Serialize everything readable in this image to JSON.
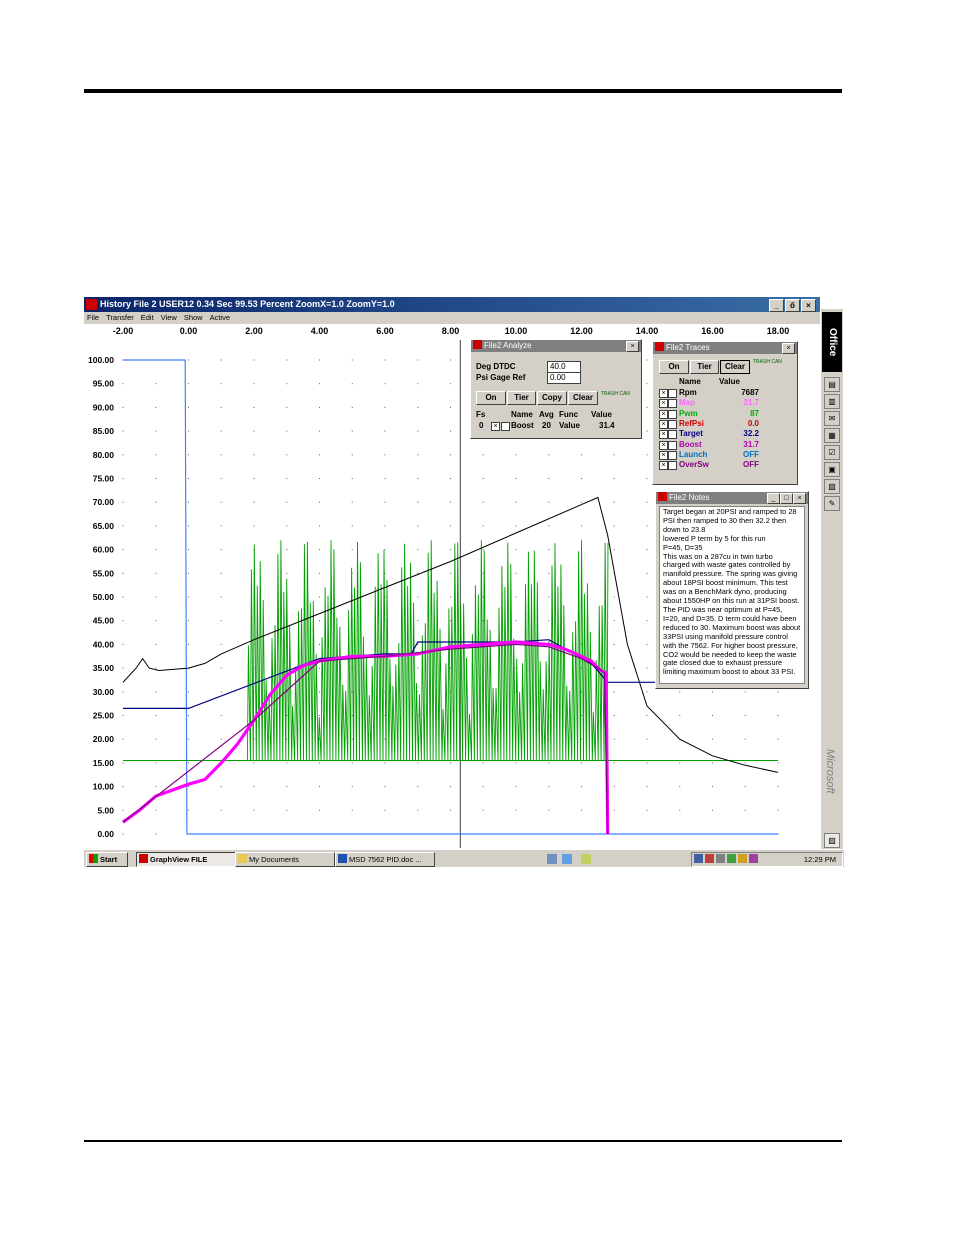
{
  "window": {
    "title": "History File 2   USER12   0.34 Sec  99.53 Percent  ZoomX=1.0  ZoomY=1.0",
    "menu": [
      "File",
      "Transfer",
      "Edit",
      "View",
      "Show",
      "Active"
    ],
    "buttons": [
      "_",
      "ő",
      "×"
    ]
  },
  "chart_data": {
    "type": "line",
    "title": "",
    "xlabel": "",
    "ylabel": "",
    "x_ticks": [
      "-2.00",
      "0.00",
      "2.00",
      "4.00",
      "6.00",
      "8.00",
      "10.00",
      "12.00",
      "14.00",
      "16.00",
      "18.00"
    ],
    "y_ticks": [
      "100.00",
      "95.00",
      "90.00",
      "85.00",
      "80.00",
      "75.00",
      "70.00",
      "65.00",
      "60.00",
      "55.00",
      "50.00",
      "45.00",
      "40.00",
      "35.00",
      "30.00",
      "25.00",
      "20.00",
      "15.00",
      "10.00",
      "5.00",
      "0.00"
    ],
    "xlim": [
      -2,
      18.7
    ],
    "ylim": [
      0,
      100
    ],
    "grid": true,
    "cursor_x": 8.3,
    "series": [
      {
        "name": "Rpm",
        "color": "#000000",
        "x": [
          -2.0,
          -1.6,
          -1.4,
          -1.2,
          -0.9,
          0.0,
          0.5,
          1.0,
          2.0,
          4.0,
          6.0,
          8.0,
          10.0,
          12.0,
          12.5,
          12.8,
          13.4,
          14.0,
          15.0,
          16.0,
          17.0,
          18.0
        ],
        "values": [
          32,
          35,
          37,
          35,
          34.5,
          35,
          36,
          38,
          41,
          46.5,
          52,
          57.5,
          63.5,
          69.5,
          71,
          63,
          40,
          27,
          20,
          16.5,
          14.5,
          13
        ]
      },
      {
        "name": "Map",
        "color": "#ff00ff",
        "x": [
          -2.0,
          -1.5,
          -1.0,
          0.0,
          0.5,
          1.0,
          1.5,
          2.0,
          2.5,
          3.0,
          3.5,
          4.0,
          5.0,
          6.0,
          7.0,
          8.0,
          9.0,
          10.0,
          11.0,
          11.5,
          12.0,
          12.3,
          12.5,
          12.6,
          12.75,
          12.8
        ],
        "values": [
          2.5,
          5,
          8,
          10.5,
          11.5,
          15,
          19,
          24,
          29.5,
          33.5,
          35.5,
          36.5,
          37.5,
          37.5,
          38,
          39.5,
          40,
          40.5,
          40,
          39,
          37.5,
          36.5,
          35,
          34.5,
          34,
          0
        ]
      },
      {
        "name": "Target",
        "color": "#000080",
        "x": [
          -2.0,
          0.0,
          4.0,
          6.0,
          6.8,
          7.0,
          10.0,
          11.0,
          12.3,
          12.8,
          18.0
        ],
        "values": [
          26.5,
          26.5,
          37,
          38,
          38,
          40.5,
          40.5,
          41,
          36,
          32,
          32
        ]
      },
      {
        "name": "Boost",
        "color": "#800080",
        "x": [
          -2.0,
          2.0,
          4.0,
          6.0,
          8.0,
          10.0,
          11.0,
          12.0,
          12.5,
          12.7,
          12.8
        ],
        "values": [
          2.5,
          24,
          36.5,
          37.5,
          39,
          40,
          39.5,
          37,
          35,
          34,
          0
        ]
      },
      {
        "name": "Pwm",
        "color": "#00a000",
        "x": [
          -2.0,
          1.8,
          18.0
        ],
        "values": [
          15.5,
          15.5,
          15.5
        ],
        "oscillation": {
          "from": 1.8,
          "to": 12.8,
          "min": 15.5,
          "max": 62
        }
      },
      {
        "name": "RefPsi",
        "color": "#4080ff",
        "x": [
          -2.0,
          -0.1,
          -0.05,
          0.05,
          18.0
        ],
        "values": [
          100,
          100,
          0,
          0,
          0
        ]
      }
    ]
  },
  "analyze": {
    "title": "File2 Analyze",
    "deg_label": "Deg DTDC",
    "deg_value": "40.0",
    "psi_label": "Psi Gage Ref",
    "psi_value": "0.00",
    "buttons": [
      "On",
      "Tier",
      "Copy",
      "Clear"
    ],
    "trash": "TRASH CAN",
    "headers": [
      "Fs",
      "Name",
      "Avg",
      "Func",
      "Value"
    ],
    "row": {
      "fs": "0",
      "name": "Boost",
      "avg": "20",
      "func": "Value",
      "value": "31.4"
    }
  },
  "traces": {
    "title": "File2 Traces",
    "buttons": [
      "On",
      "Tier",
      "Clear"
    ],
    "trash": "TRASH CAN",
    "headers": [
      "Name",
      "Value"
    ],
    "rows": [
      {
        "name": "Rpm",
        "value": "7687",
        "color": "#000000"
      },
      {
        "name": "Map",
        "value": "31.7",
        "color": "#ff66ff"
      },
      {
        "name": "Pwm",
        "value": "87",
        "color": "#00b000"
      },
      {
        "name": "RefPsi",
        "value": "0.0",
        "color": "#cc0000"
      },
      {
        "name": "Target",
        "value": "32.2",
        "color": "#000080"
      },
      {
        "name": "Boost",
        "value": "31.7",
        "color": "#b000b0"
      },
      {
        "name": "Launch",
        "value": "OFF",
        "color": "#0070c0"
      },
      {
        "name": "OverSw",
        "value": "OFF",
        "color": "#800080"
      }
    ]
  },
  "notes": {
    "title": "File2 Notes",
    "text": "Target began at 20PSI and ramped to 28 PSI then  ramped to 30 then  32.2 then down to 23.8\nlowered P term by 5 for this run\nP=45, D=35\nThis was on a 287cu in twin turbo charged with waste gates controlled by manifold pressure. The spring was giving about 18PSI boost minimum. This test was on a BenchMark dyno, producing about 1550HP on this run at 31PSI boost.\nThe PID was near optimum at P=45, I=20, and D=35.  D term could have been reduced to 30. Maximum boost was  about 33PSI using manifold pressure  control with the 7562. For higher boost  pressure, CO2 would be needed to  keep the waste gate closed due to  exhaust pressure limiting maximum boost  to about 33 PSI."
  },
  "officebar": {
    "label": "Office",
    "brand": "Microsoft"
  },
  "taskbar": {
    "start": "Start",
    "items": [
      "GraphView FILE",
      "My Documents",
      "MSD 7562 PID.doc ..."
    ],
    "clock": "12:29 PM"
  }
}
